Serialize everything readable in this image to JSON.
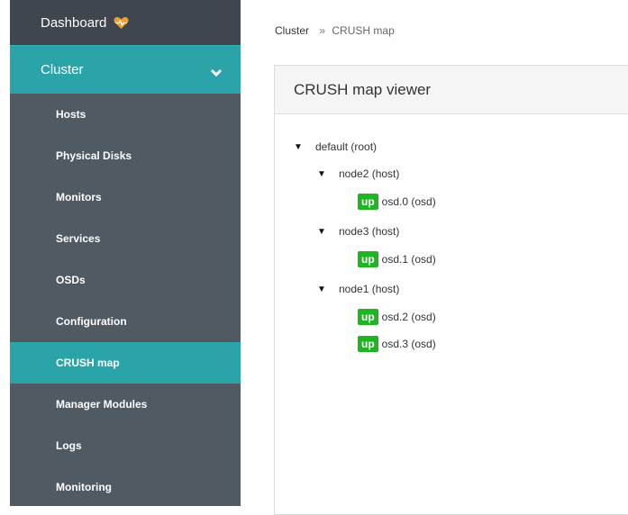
{
  "sidebar": {
    "dashboard_label": "Dashboard",
    "cluster_label": "Cluster",
    "items": [
      {
        "label": "Hosts"
      },
      {
        "label": "Physical Disks"
      },
      {
        "label": "Monitors"
      },
      {
        "label": "Services"
      },
      {
        "label": "OSDs"
      },
      {
        "label": "Configuration"
      },
      {
        "label": "CRUSH map",
        "active": true
      },
      {
        "label": "Manager Modules"
      },
      {
        "label": "Logs"
      },
      {
        "label": "Monitoring"
      }
    ],
    "colors": {
      "background": "#4f5a63",
      "dashboard_bg": "#3f464d",
      "accent": "#2aa3a9",
      "heart": "#f0a02a"
    }
  },
  "breadcrumb": {
    "parent": "Cluster",
    "separator": "»",
    "current": "CRUSH map"
  },
  "panel": {
    "title": "CRUSH map viewer"
  },
  "tree": {
    "root": "default (root)",
    "hosts": [
      {
        "label": "node2 (host)",
        "osds": [
          {
            "status": "up",
            "label": "osd.0 (osd)"
          }
        ]
      },
      {
        "label": "node3 (host)",
        "osds": [
          {
            "status": "up",
            "label": "osd.1 (osd)"
          }
        ]
      },
      {
        "label": "node1 (host)",
        "osds": [
          {
            "status": "up",
            "label": "osd.2 (osd)"
          },
          {
            "status": "up",
            "label": "osd.3 (osd)"
          }
        ]
      }
    ],
    "expand_glyph": "▼",
    "status_color": "#1fb422"
  }
}
